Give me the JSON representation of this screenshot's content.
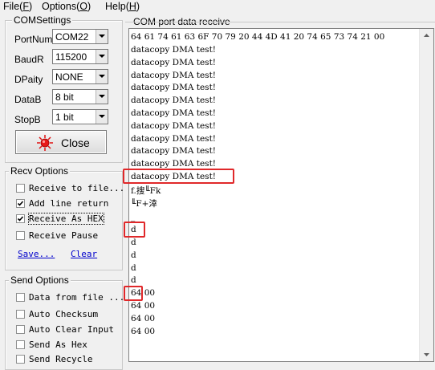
{
  "menu": [
    "File(F)",
    "Options(O)",
    "Help(H)"
  ],
  "com_settings": {
    "title": "COMSettings",
    "portnum_label": "PortNum",
    "portnum_value": "COM22",
    "baud_label": "BaudR",
    "baud_value": "115200",
    "parity_label": "DPaity",
    "parity_value": "NONE",
    "databits_label": "DataB",
    "databits_value": "8 bit",
    "stopbits_label": "StopB",
    "stopbits_value": "1 bit",
    "close_label": "Close"
  },
  "recv_options": {
    "title": "Recv Options",
    "items": [
      {
        "label": "Receive to file...",
        "checked": false
      },
      {
        "label": "Add line return",
        "checked": true
      },
      {
        "label": "Receive As HEX",
        "checked": true
      },
      {
        "label": "Receive Pause",
        "checked": false
      }
    ],
    "save_link": "Save...",
    "clear_link": "Clear"
  },
  "send_options": {
    "title": "Send Options",
    "items": [
      {
        "label": "Data from file ...",
        "checked": false
      },
      {
        "label": "Auto Checksum",
        "checked": false
      },
      {
        "label": "Auto Clear Input",
        "checked": false
      },
      {
        "label": "Send As Hex",
        "checked": false
      },
      {
        "label": "Send Recycle",
        "checked": false
      }
    ]
  },
  "receive_panel": {
    "title": "COM port data receive",
    "lines": [
      "64 61 74 61 63 6F 70 79 20 44 4D 41 20 74 65 73 74 21 00",
      "datacopy DMA test!",
      "datacopy DMA test!",
      "datacopy DMA test!",
      "datacopy DMA test!",
      "datacopy DMA test!",
      "datacopy DMA test!",
      "datacopy DMA test!",
      "datacopy DMA test!",
      "datacopy DMA test!",
      "datacopy DMA test!",
      "datacopy DMA test!",
      "f.搜╙Fk",
      "╙F+涬",
      "_",
      "d",
      "d",
      "d",
      "d",
      "d",
      "64 00",
      "64 00",
      "64 00",
      "64 00"
    ]
  },
  "colors": {
    "highlight": "#e0282a",
    "link": "#0000cc"
  }
}
